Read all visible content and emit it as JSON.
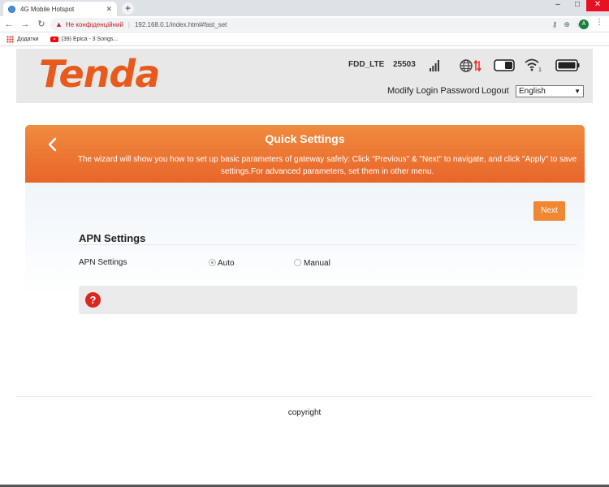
{
  "browser": {
    "tab_title": "4G Mobile Hotspot",
    "tab_close": "✕",
    "new_tab": "+",
    "window_controls": [
      "–",
      "□",
      "✕"
    ],
    "nav": {
      "back": "←",
      "forward": "→",
      "reload": "↻"
    },
    "security_text": "Не конфіденційний",
    "url": "192.168.0.1/index.html#fast_set",
    "profile_initial": "A",
    "omnibox_icons": [
      "key-icon",
      "zoom-icon",
      "star-icon"
    ],
    "bookmarks": [
      {
        "label": "Додатки",
        "icon": "apps-icon"
      },
      {
        "label": "(39) Epica - 3 Songs...",
        "icon": "youtube-icon"
      }
    ]
  },
  "header": {
    "logo_text": "Tenda",
    "network_mode": "FDD_LTE",
    "carrier": "25503",
    "wifi_clients": "1",
    "modify_password": "Modify Login Password",
    "logout": "Logout",
    "language": "English"
  },
  "wizard": {
    "title": "Quick Settings",
    "description": "The wizard will show you how to set up basic parameters of gateway safely: Click \"Previous\" & \"Next\" to navigate, and click \"Apply\" to save settings.For advanced parameters, set them in other menu.",
    "next_label": "Next"
  },
  "apn": {
    "section_title": "APN Settings",
    "field_label": "APN Settings",
    "options": [
      {
        "label": "Auto",
        "selected": true
      },
      {
        "label": "Manual",
        "selected": false
      }
    ]
  },
  "help": {
    "icon_glyph": "?"
  },
  "footer": {
    "copyright": "copyright"
  },
  "colors": {
    "accent_orange": "#e8652a",
    "logo_orange": "#e85a1c",
    "button_orange": "#ef8832",
    "help_red": "#d8281f"
  }
}
